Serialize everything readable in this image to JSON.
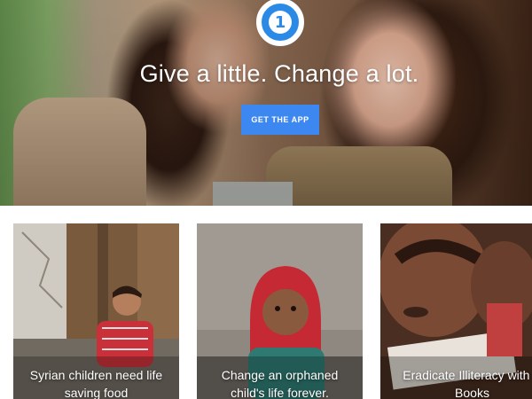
{
  "hero": {
    "logo_glyph": "1",
    "tagline": "Give a little. Change a lot.",
    "cta_label": "GET THE APP",
    "accent_color": "#3d88f0",
    "logo_color": "#2b8ae6"
  },
  "cards": [
    {
      "title_line1": "Syrian children need life",
      "title_line2": "saving food"
    },
    {
      "title_line1": "Change an orphaned",
      "title_line2": "child's life forever."
    },
    {
      "title_line1": "Eradicate Illiteracy with E",
      "title_line2": "Books"
    }
  ]
}
